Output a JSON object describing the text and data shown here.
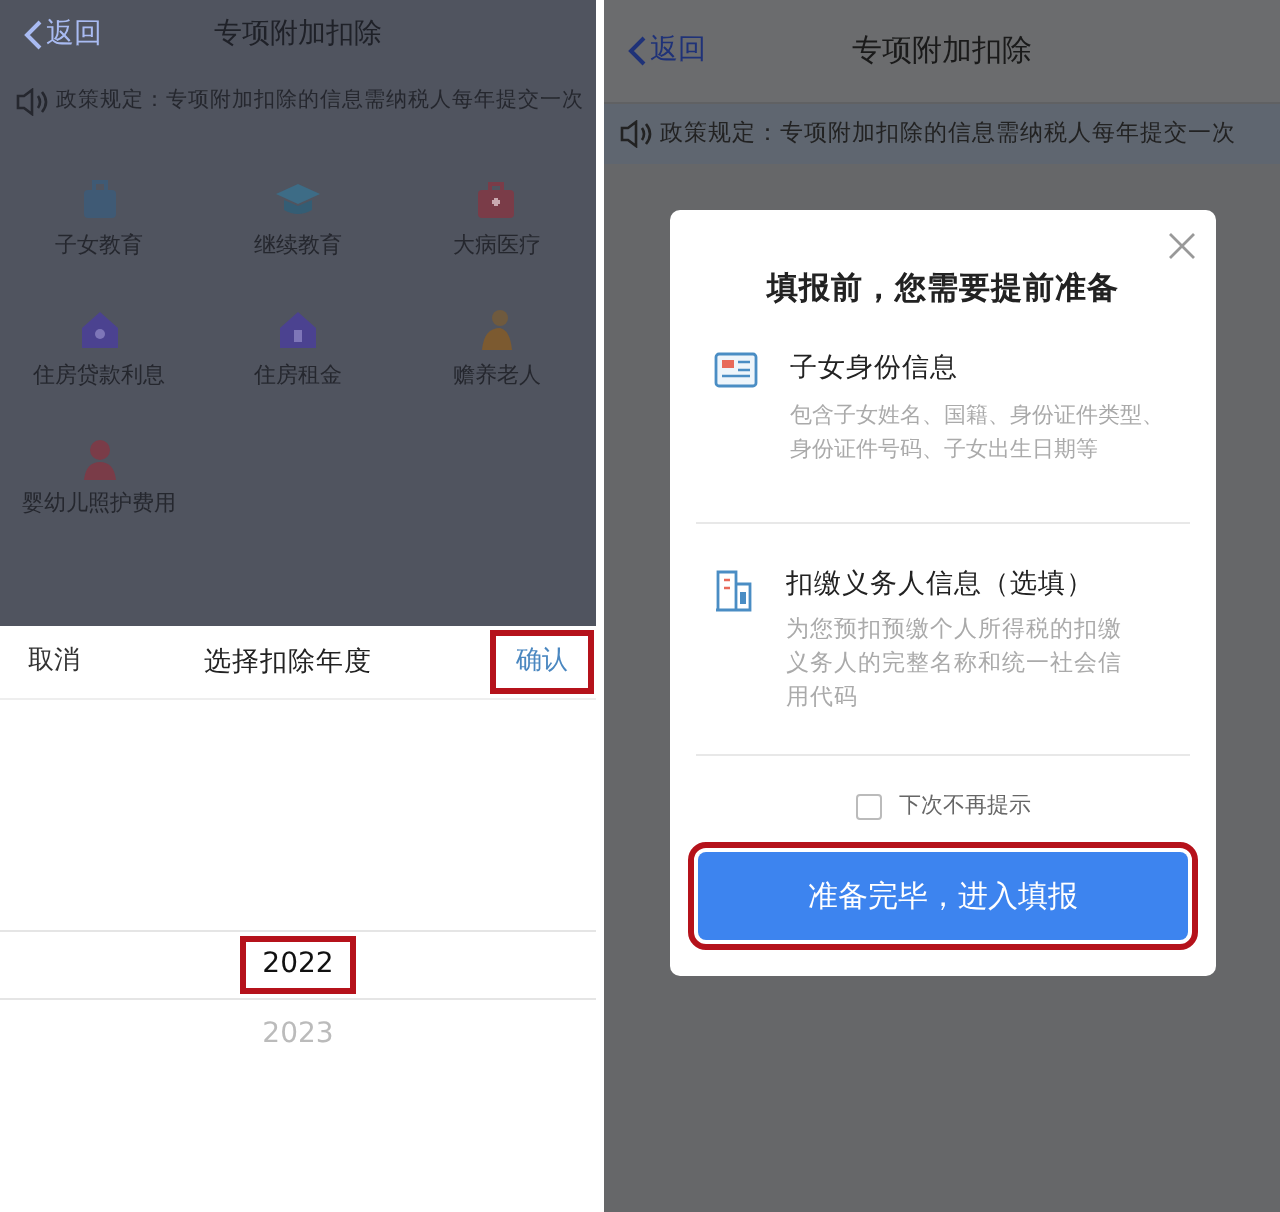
{
  "left_screen": {
    "header": {
      "back": "返回",
      "title": "专项附加扣除"
    },
    "notice": "政策规定：专项附加扣除的信息需纳税人每年提交一次",
    "categories": [
      {
        "label": "子女教育"
      },
      {
        "label": "继续教育"
      },
      {
        "label": "大病医疗"
      },
      {
        "label": "住房贷款利息"
      },
      {
        "label": "住房租金"
      },
      {
        "label": "赡养老人"
      },
      {
        "label": "婴幼儿照护费用"
      }
    ],
    "picker": {
      "cancel": "取消",
      "title": "选择扣除年度",
      "confirm": {
        "label": "确认",
        "highlighted": true
      },
      "years": [
        {
          "label": "2022",
          "selected": true,
          "highlighted": true
        },
        {
          "label": "2023",
          "selected": false,
          "highlighted": false
        }
      ]
    }
  },
  "right_screen": {
    "header": {
      "back": "返回",
      "title": "专项附加扣除"
    },
    "notice": "政策规定：专项附加扣除的信息需纳税人每年提交一次",
    "dialog": {
      "title": "填报前，您需要提前准备",
      "items": [
        {
          "title": "子女身份信息",
          "description": "包含子女姓名、国籍、身份证件类型、身份证件号码、子女出生日期等"
        },
        {
          "title": "扣缴义务人信息（选填）",
          "description": "为您预扣预缴个人所得税的扣缴义务人的完整名称和统一社会信用代码"
        }
      ],
      "dont_show_again": {
        "label": "下次不再提示",
        "checked": false
      },
      "primary_button": {
        "label": "准备完毕，进入填报",
        "highlighted": true
      }
    }
  }
}
